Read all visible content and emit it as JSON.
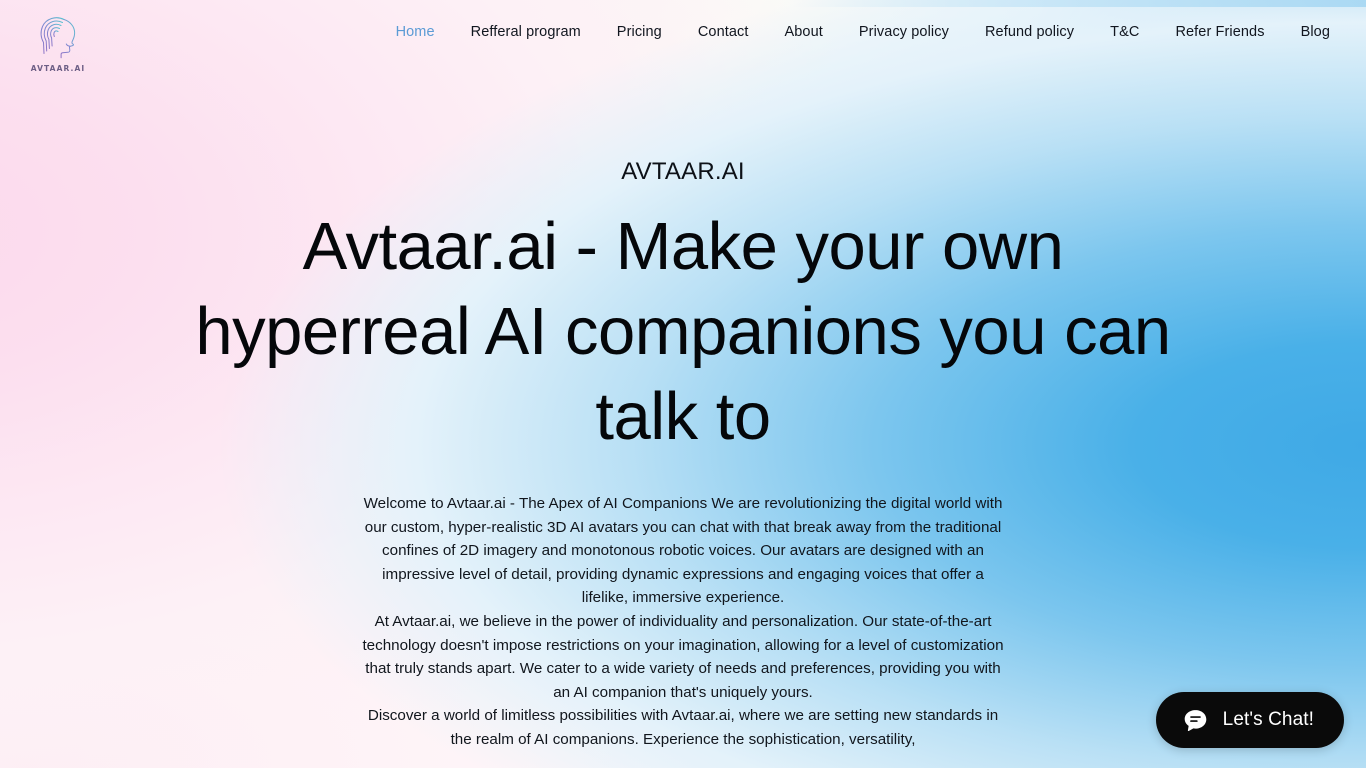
{
  "brand": {
    "logo_icon": "head-profile-logo-icon",
    "logo_text": "AVTAAR.AI"
  },
  "nav": {
    "items": [
      {
        "label": "Home",
        "active": true
      },
      {
        "label": "Refferal program",
        "active": false
      },
      {
        "label": "Pricing",
        "active": false
      },
      {
        "label": "Contact",
        "active": false
      },
      {
        "label": "About",
        "active": false
      },
      {
        "label": "Privacy policy",
        "active": false
      },
      {
        "label": "Refund policy",
        "active": false
      },
      {
        "label": "T&C",
        "active": false
      },
      {
        "label": "Refer Friends",
        "active": false
      },
      {
        "label": "Blog",
        "active": false
      }
    ],
    "active_color": "#5b9bd5"
  },
  "hero": {
    "eyebrow": "AVTAAR.AI",
    "headline": "Avtaar.ai - Make your own hyperreal AI companions you can talk to",
    "paragraphs": [
      "Welcome to Avtaar.ai - The Apex of AI Companions  We are revolutionizing the digital world with our custom, hyper-realistic 3D AI avatars you can chat with that break away from the traditional confines of 2D imagery and monotonous robotic voices. Our avatars are designed with an impressive level of detail, providing dynamic expressions and engaging voices that offer a lifelike, immersive experience.",
      "At Avtaar.ai, we believe in the power of individuality and personalization. Our state-of-the-art technology doesn't impose restrictions on your imagination, allowing for a level of customization that truly stands apart. We cater to a wide variety of needs and preferences, providing you with an AI companion that's uniquely yours.",
      "Discover a world of limitless possibilities with Avtaar.ai, where we are setting new standards in the realm of AI companions. Experience the sophistication, versatility,"
    ]
  },
  "chat_widget": {
    "label": "Let's Chat!",
    "icon": "chat-bubble-icon",
    "background_color": "#0a0a0a",
    "text_color": "#ffffff"
  },
  "theme": {
    "background_pink": "#fde4f1",
    "background_white": "#fbfaf7",
    "background_blue": "#42abe4",
    "text_color": "#0d1117"
  }
}
